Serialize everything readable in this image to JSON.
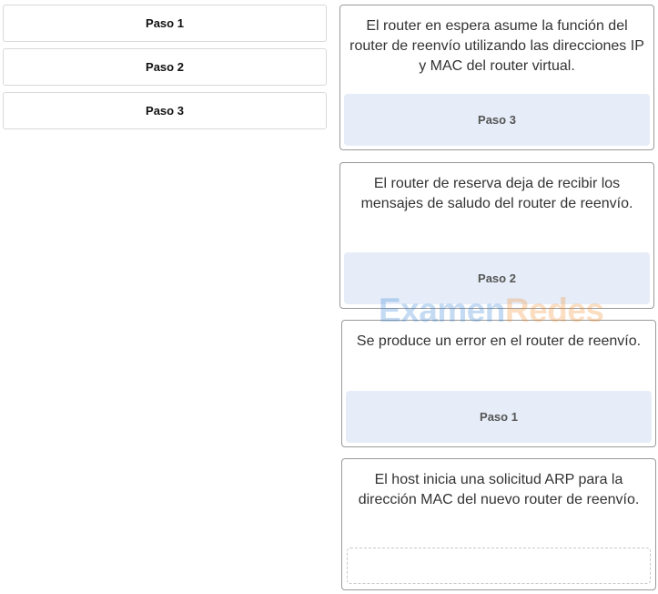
{
  "source_items": [
    {
      "label": "Paso 1"
    },
    {
      "label": "Paso 2"
    },
    {
      "label": "Paso 3"
    }
  ],
  "cards": [
    {
      "text": "El router en espera asume la función del router de reenvío utilizando las direcciones IP y MAC del router virtual.",
      "answer": "Paso 3"
    },
    {
      "text": "El router de reserva deja de recibir los mensajes de saludo del router de reenvío.",
      "answer": "Paso 2"
    },
    {
      "text": "Se produce un error en el router de reenvío.",
      "answer": "Paso 1"
    },
    {
      "text": "El host inicia una solicitud ARP para la dirección MAC del nuevo router de reenvío.",
      "answer": ""
    }
  ],
  "watermark": {
    "part1": "Examen",
    "part2": "Redes"
  },
  "colors": {
    "drop_filled": "#e6edf8",
    "watermark_blue": "#2f7fd6",
    "watermark_orange": "#f28c28"
  }
}
